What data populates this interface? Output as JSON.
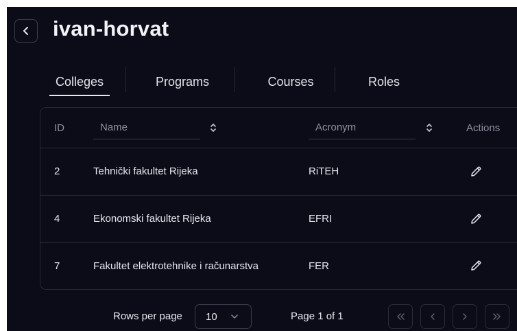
{
  "header": {
    "title": "ivan-horvat"
  },
  "tabs": [
    {
      "label": "Colleges",
      "active": true
    },
    {
      "label": "Programs",
      "active": false
    },
    {
      "label": "Courses",
      "active": false
    },
    {
      "label": "Roles",
      "active": false
    }
  ],
  "table": {
    "columns": {
      "id": "ID",
      "name": "Name",
      "acronym": "Acronym",
      "actions": "Actions"
    },
    "rows": [
      {
        "id": "2",
        "name": "Tehnički fakultet Rijeka",
        "acronym": "RiTEH"
      },
      {
        "id": "4",
        "name": "Ekonomski fakultet Rijeka",
        "acronym": "EFRI"
      },
      {
        "id": "7",
        "name": "Fakultet elektrotehnike i računarstva",
        "acronym": "FER"
      }
    ]
  },
  "pagination": {
    "rows_per_page_label": "Rows per page",
    "rows_per_page_value": "10",
    "page_info": "Page 1 of 1"
  },
  "colors": {
    "background": "#0b0c17",
    "border": "#262837",
    "muted_text": "#8c90a3",
    "text": "#e6e8ee"
  },
  "icons": [
    "chevron-left-icon",
    "sort-icon",
    "pencil-icon",
    "chevron-down-icon",
    "chevrons-left-icon",
    "chevron-right-icon",
    "chevrons-right-icon"
  ]
}
